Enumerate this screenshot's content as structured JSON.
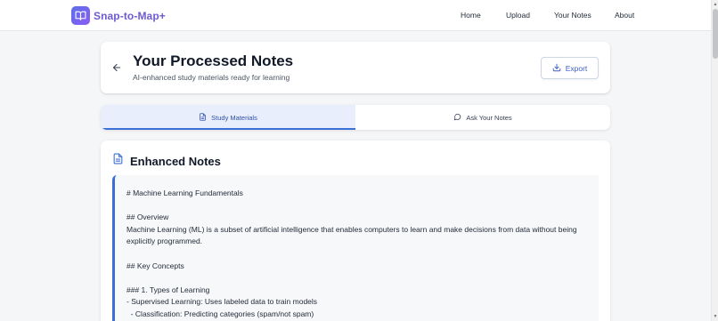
{
  "nav": {
    "brand": "Snap-to-Map+",
    "links": [
      "Home",
      "Upload",
      "Your Notes",
      "About"
    ]
  },
  "header": {
    "title": "Your Processed Notes",
    "subtitle": "AI-enhanced study materials ready for learning",
    "export_label": "Export"
  },
  "tabs": [
    {
      "label": "Study Materials",
      "icon": "document-icon",
      "active": true
    },
    {
      "label": "Ask Your Notes",
      "icon": "chat-bubble-icon",
      "active": false
    }
  ],
  "section": {
    "title": "Enhanced Notes",
    "icon": "document-icon"
  },
  "notes": {
    "lines": [
      "# Machine Learning Fundamentals",
      "",
      "## Overview",
      "Machine Learning (ML) is a subset of artificial intelligence that enables computers to learn and make decisions from data without being",
      "explicitly programmed.",
      "",
      "## Key Concepts",
      "",
      "### 1. Types of Learning",
      "- Supervised Learning: Uses labeled data to train models",
      "  - Classification: Predicting categories (spam/not spam)"
    ]
  },
  "colors": {
    "accent": "#3b6fd8",
    "brand": "#6d5bd0",
    "active_tab_bg": "#e8eefb"
  }
}
